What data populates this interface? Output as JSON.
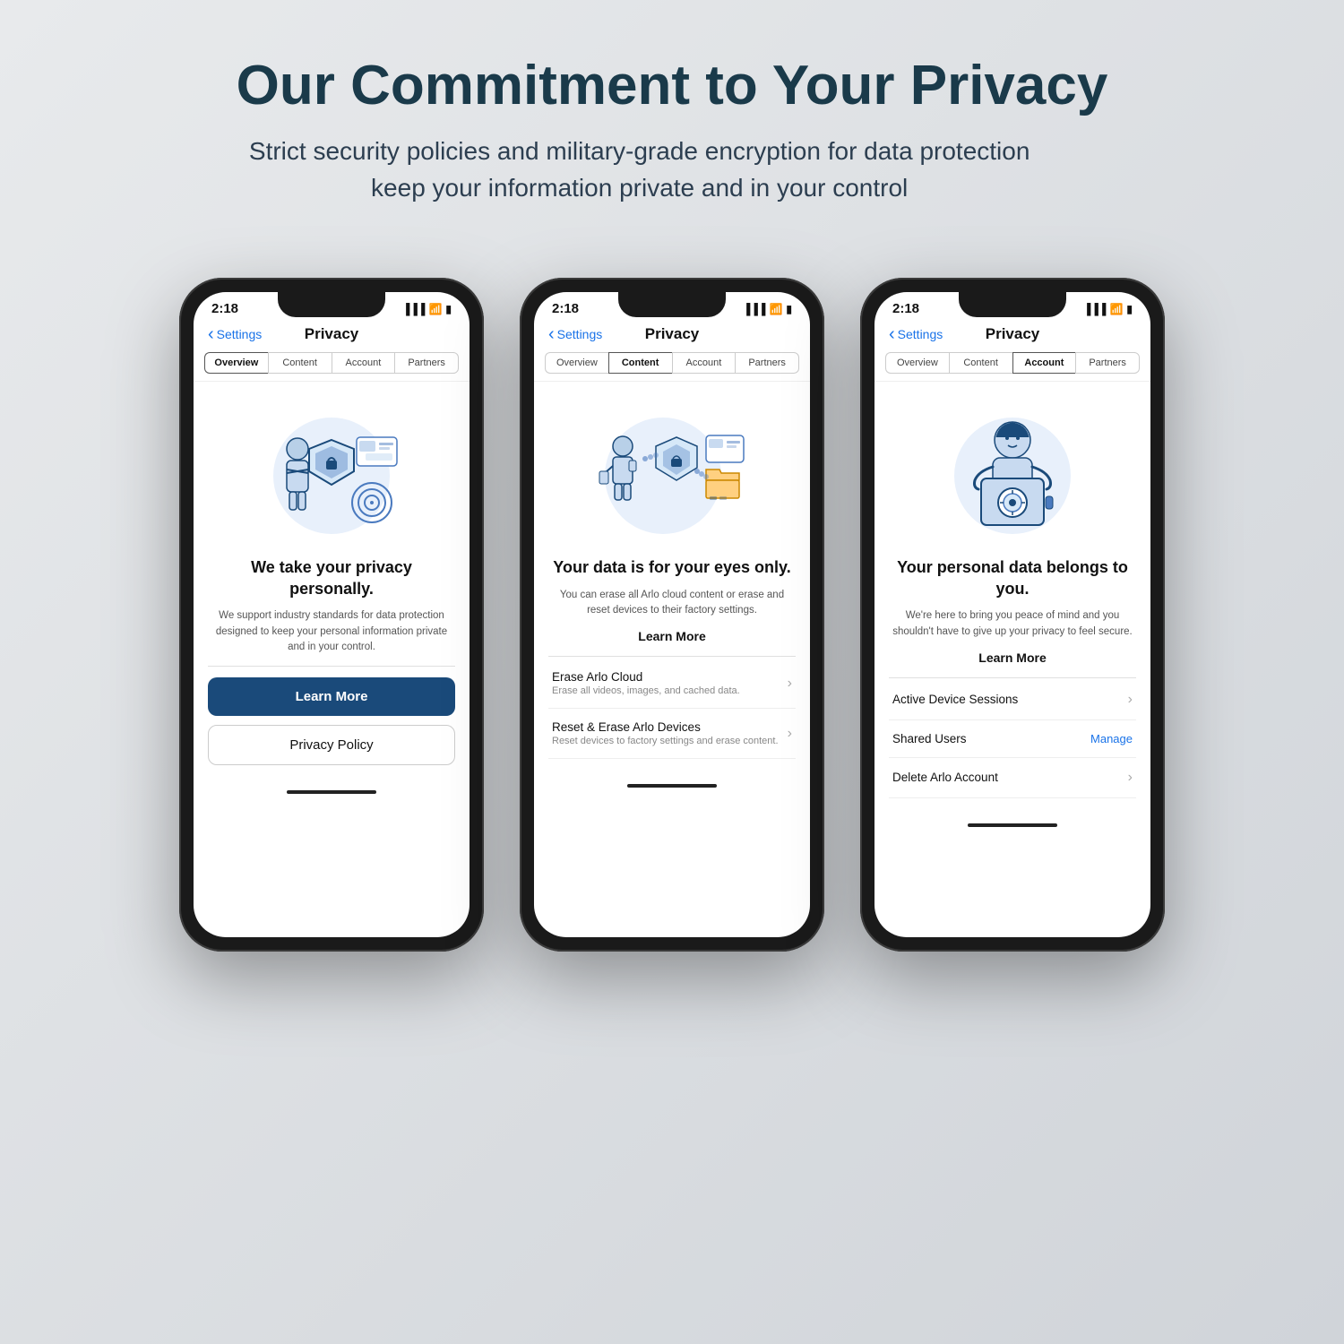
{
  "header": {
    "title": "Our Commitment to Your Privacy",
    "subtitle": "Strict security policies and military-grade encryption for data protection keep your information private and in your control"
  },
  "phones": [
    {
      "id": "phone1",
      "time": "2:18",
      "nav_back": "Settings",
      "nav_title": "Privacy",
      "tabs": [
        "Overview",
        "Content",
        "Account",
        "Partners"
      ],
      "active_tab": "Overview",
      "heading": "We take your privacy personally.",
      "subtext": "We support industry standards for data protection designed to keep your personal information private and in your control.",
      "has_learn_more_link": false,
      "btn_primary": "Learn More",
      "btn_secondary": "Privacy Policy",
      "list_items": []
    },
    {
      "id": "phone2",
      "time": "2:18",
      "nav_back": "Settings",
      "nav_title": "Privacy",
      "tabs": [
        "Overview",
        "Content",
        "Account",
        "Partners"
      ],
      "active_tab": "Content",
      "heading": "Your data is for your eyes only.",
      "subtext": "You can erase all Arlo cloud content or erase and reset devices to their factory settings.",
      "has_learn_more_link": true,
      "learn_more_label": "Learn More",
      "btn_primary": null,
      "btn_secondary": null,
      "list_items": [
        {
          "title": "Erase Arlo Cloud",
          "subtitle": "Erase all videos, images, and cached data.",
          "right": "chevron"
        },
        {
          "title": "Reset & Erase Arlo Devices",
          "subtitle": "Reset devices to factory settings and erase content.",
          "right": "chevron"
        }
      ]
    },
    {
      "id": "phone3",
      "time": "2:18",
      "nav_back": "Settings",
      "nav_title": "Privacy",
      "tabs": [
        "Overview",
        "Content",
        "Account",
        "Partners"
      ],
      "active_tab": "Account",
      "heading": "Your personal data belongs to you.",
      "subtext": "We're here to bring you peace of mind and you shouldn't have to give up your privacy to feel secure.",
      "has_learn_more_link": true,
      "learn_more_label": "Learn More",
      "btn_primary": null,
      "btn_secondary": null,
      "list_items": [
        {
          "title": "Active Device Sessions",
          "subtitle": "",
          "right": "chevron"
        },
        {
          "title": "Shared Users",
          "subtitle": "",
          "right": "Manage"
        },
        {
          "title": "Delete Arlo Account",
          "subtitle": "",
          "right": "chevron"
        }
      ]
    }
  ]
}
